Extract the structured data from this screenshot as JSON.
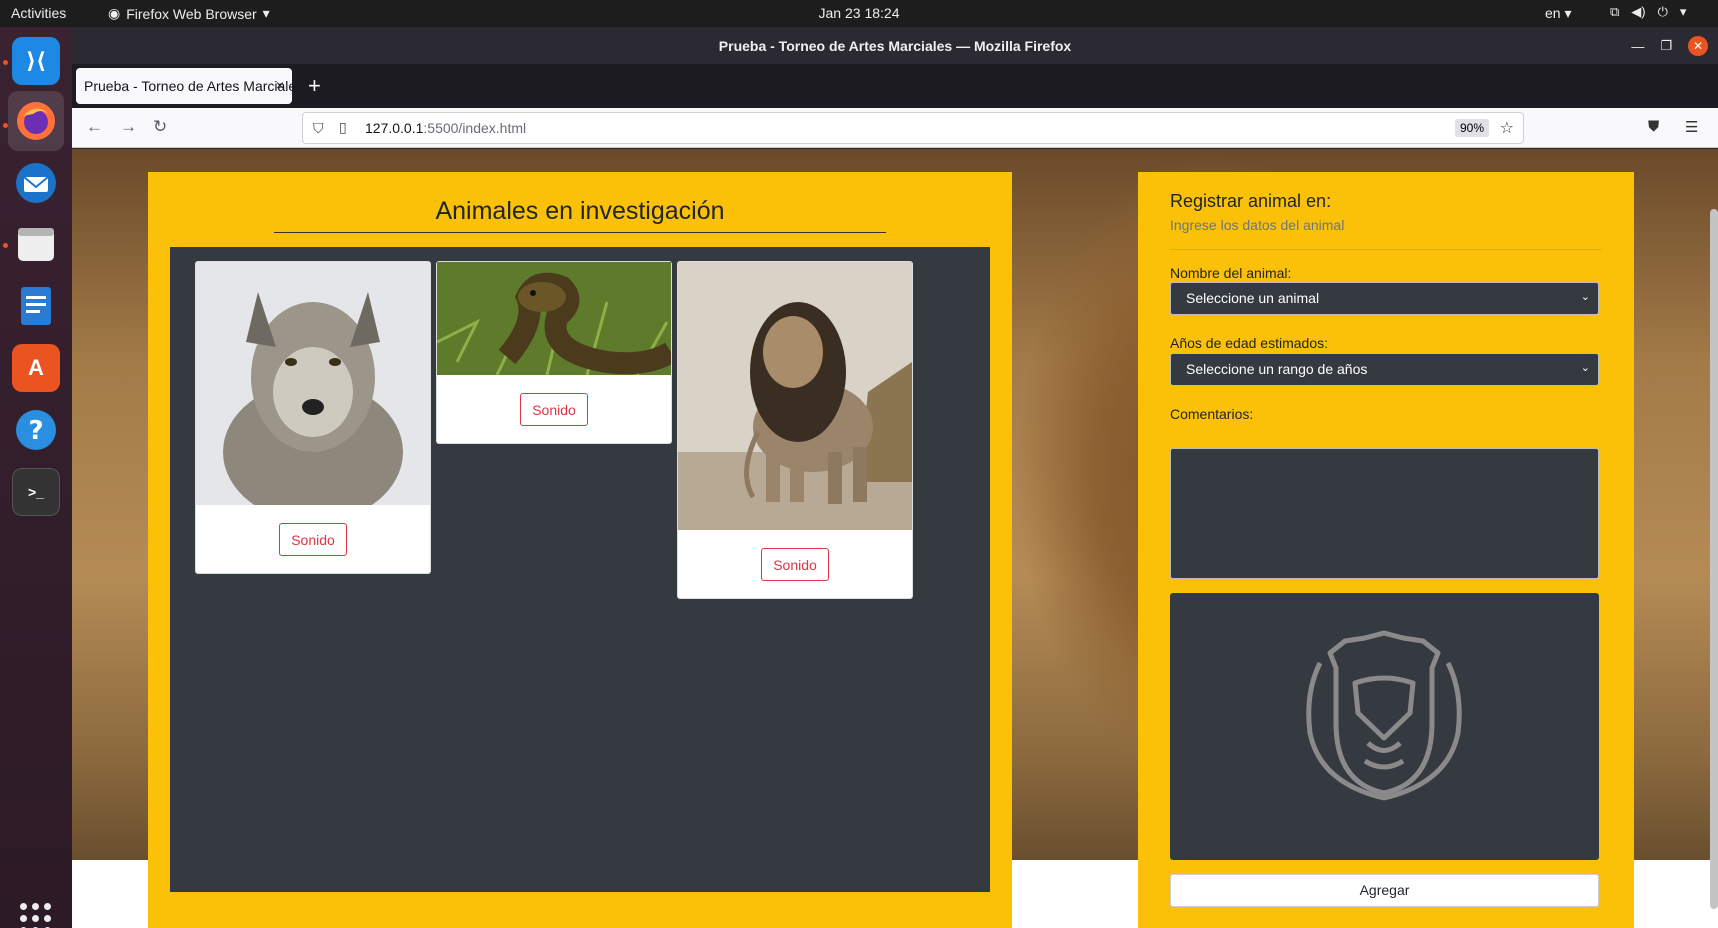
{
  "topbar": {
    "activities": "Activities",
    "app_menu": "Firefox Web Browser",
    "clock": "Jan 23  18:24",
    "language": "en"
  },
  "window": {
    "title": "Prueba - Torneo de Artes Marciales — Mozilla Firefox"
  },
  "tab": {
    "label": "Prueba - Torneo de Artes Marciales",
    "close": "×",
    "new_tab": "+"
  },
  "urlbar": {
    "host": "127.0.0.1",
    "rest": ":5500/index.html",
    "zoom": "90%"
  },
  "left_panel": {
    "heading": "Animales en investigación",
    "cards": [
      {
        "animal": "wolf",
        "button": "Sonido"
      },
      {
        "animal": "snake",
        "button": "Sonido"
      },
      {
        "animal": "lion",
        "button": "Sonido"
      }
    ]
  },
  "form": {
    "title": "Registrar animal en:",
    "subtitle": "Ingrese los datos del animal",
    "animal_label": "Nombre del animal:",
    "animal_select": "Seleccione un animal",
    "age_label": "Años de edad estimados:",
    "age_select": "Seleccione un rango de años",
    "comments_label": "Comentarios:",
    "comments_value": "",
    "submit": "Agregar"
  },
  "colors": {
    "panel_yellow": "#fbc108",
    "dark": "#343a40",
    "sound_red": "#dc3545"
  }
}
